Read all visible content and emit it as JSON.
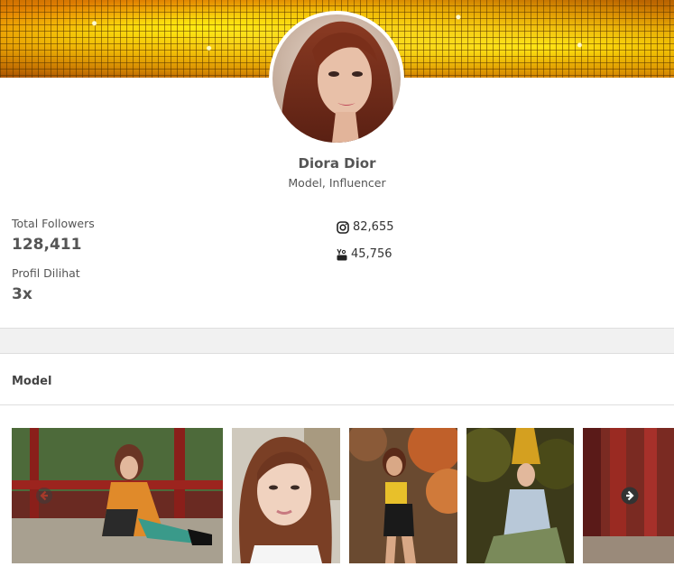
{
  "profile": {
    "name": "Diora Dior",
    "role": "Model, Influencer"
  },
  "stats": {
    "total_followers_label": "Total Followers",
    "total_followers_value": "128,411",
    "profile_views_label": "Profil Dilihat",
    "profile_views_value": "3x"
  },
  "social": [
    {
      "icon": "instagram-icon",
      "count": "82,655"
    },
    {
      "icon": "youtube-icon",
      "count": "45,756"
    }
  ],
  "section": {
    "title": "Model"
  },
  "gallery": {
    "photos": [
      {
        "subject": "model seated on red wooden bridge"
      },
      {
        "subject": "close-up portrait"
      },
      {
        "subject": "model among autumn leaves"
      },
      {
        "subject": "model in golden headdress"
      },
      {
        "subject": "model by red pillars"
      }
    ],
    "prev_icon": "arrow-left-circle-icon",
    "next_icon": "arrow-right-circle-icon"
  },
  "colors": {
    "cover_gold": "#c9981a",
    "text": "#555555",
    "band": "#f1f1f1"
  }
}
